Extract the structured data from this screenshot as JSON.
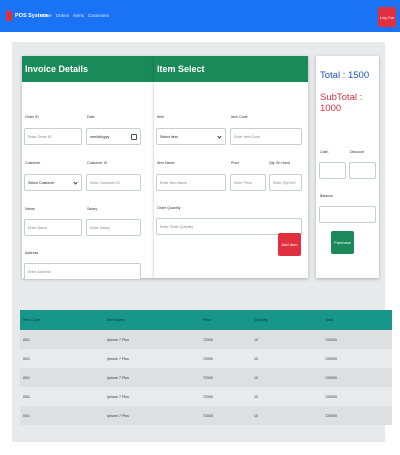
{
  "navbar": {
    "brand": "POS System",
    "links": [
      "Home",
      "Orders",
      "Items",
      "Customers"
    ],
    "logout_label": "Log Out",
    "colors": {
      "bar": "#1a73f5",
      "logout": "#e0303f"
    }
  },
  "invoice": {
    "title": "Invoice Details",
    "order_id_label": "Order ID",
    "order_id_placeholder": "Enter Order ID",
    "date_label": "Date",
    "date_value": "mm/dd/yyyy",
    "customer_label": "Customer",
    "customer_selected": "Select Customer",
    "customer_id_label": "Customer ID",
    "customer_id_placeholder": "Enter Customer ID",
    "name_label": "Name",
    "name_placeholder": "Enter Name",
    "salary_label": "Salary",
    "salary_placeholder": "Enter Salary",
    "address_label": "Address",
    "address_placeholder": "Enter Address"
  },
  "item_select": {
    "title": "Item Select",
    "item_label": "Item",
    "item_selected": "Select item",
    "item_code_label": "Item Code",
    "item_code_placeholder": "Enter Item Code",
    "item_name_label": "Item Name",
    "item_name_placeholder": "Enter Item Name",
    "price_label": "Price",
    "price_placeholder": "Enter Price",
    "qty_on_hand_label": "Qty On Hand",
    "qty_on_hand_placeholder": "Enter QtyOnH",
    "order_qty_label": "Order Quantity",
    "order_qty_placeholder": "Enter Order Quantity",
    "add_button": "Add Item"
  },
  "summary": {
    "total": "Total : 1500",
    "subtotal": "SubTotal : 1000",
    "cash_label": "Cash",
    "discount_label": "Discount",
    "balance_label": "Balance",
    "purchase_button": "Purchase"
  },
  "table": {
    "headers": [
      "Item Code",
      "Item Name",
      "Price",
      "Quantity",
      "Total"
    ],
    "rows": [
      [
        "I001",
        "Iphone 7 Plus",
        "72000",
        "10",
        "720000"
      ],
      [
        "I001",
        "Iphone 7 Plus",
        "72000",
        "10",
        "720000"
      ],
      [
        "I001",
        "Iphone 7 Plus",
        "72000",
        "10",
        "720000"
      ],
      [
        "I001",
        "Iphone 7 Plus",
        "72000",
        "10",
        "720000"
      ],
      [
        "I001",
        "Iphone 7 Plus",
        "72000",
        "10",
        "720000"
      ]
    ]
  },
  "colors": {
    "accent_green": "#1a8a5a",
    "total_blue": "#1f52c4",
    "subtotal_red": "#e03040",
    "table_header": "#17968c"
  }
}
